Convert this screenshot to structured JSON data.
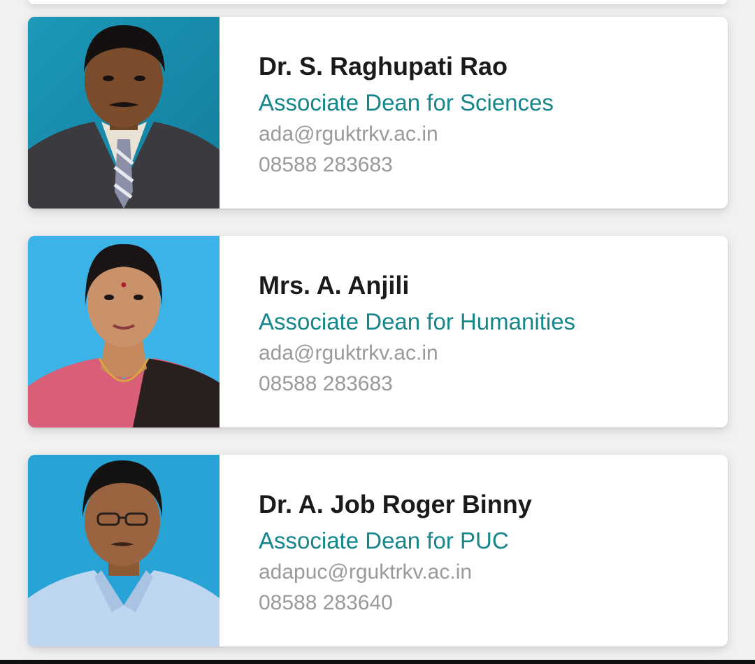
{
  "faculty": [
    {
      "name": "Dr. S. Raghupati Rao",
      "role": "Associate Dean for Sciences",
      "email": "ada@rguktrkv.ac.in",
      "phone": "08588 283683",
      "photo_background": "#1a8fb0"
    },
    {
      "name": "Mrs. A. Anjili",
      "role": "Associate Dean for Humanities",
      "email": "ada@rguktrkv.ac.in",
      "phone": "08588 283683",
      "photo_background": "#3cb3e6"
    },
    {
      "name": "Dr. A. Job Roger Binny",
      "role": "Associate Dean for PUC",
      "email": "adapuc@rguktrkv.ac.in",
      "phone": "08588 283640",
      "photo_background": "#28a3d6"
    }
  ],
  "colors": {
    "role_text": "#15868a",
    "name_text": "#1a1a1a",
    "meta_text": "#9a9a9a",
    "page_background": "#f1f1f1"
  }
}
